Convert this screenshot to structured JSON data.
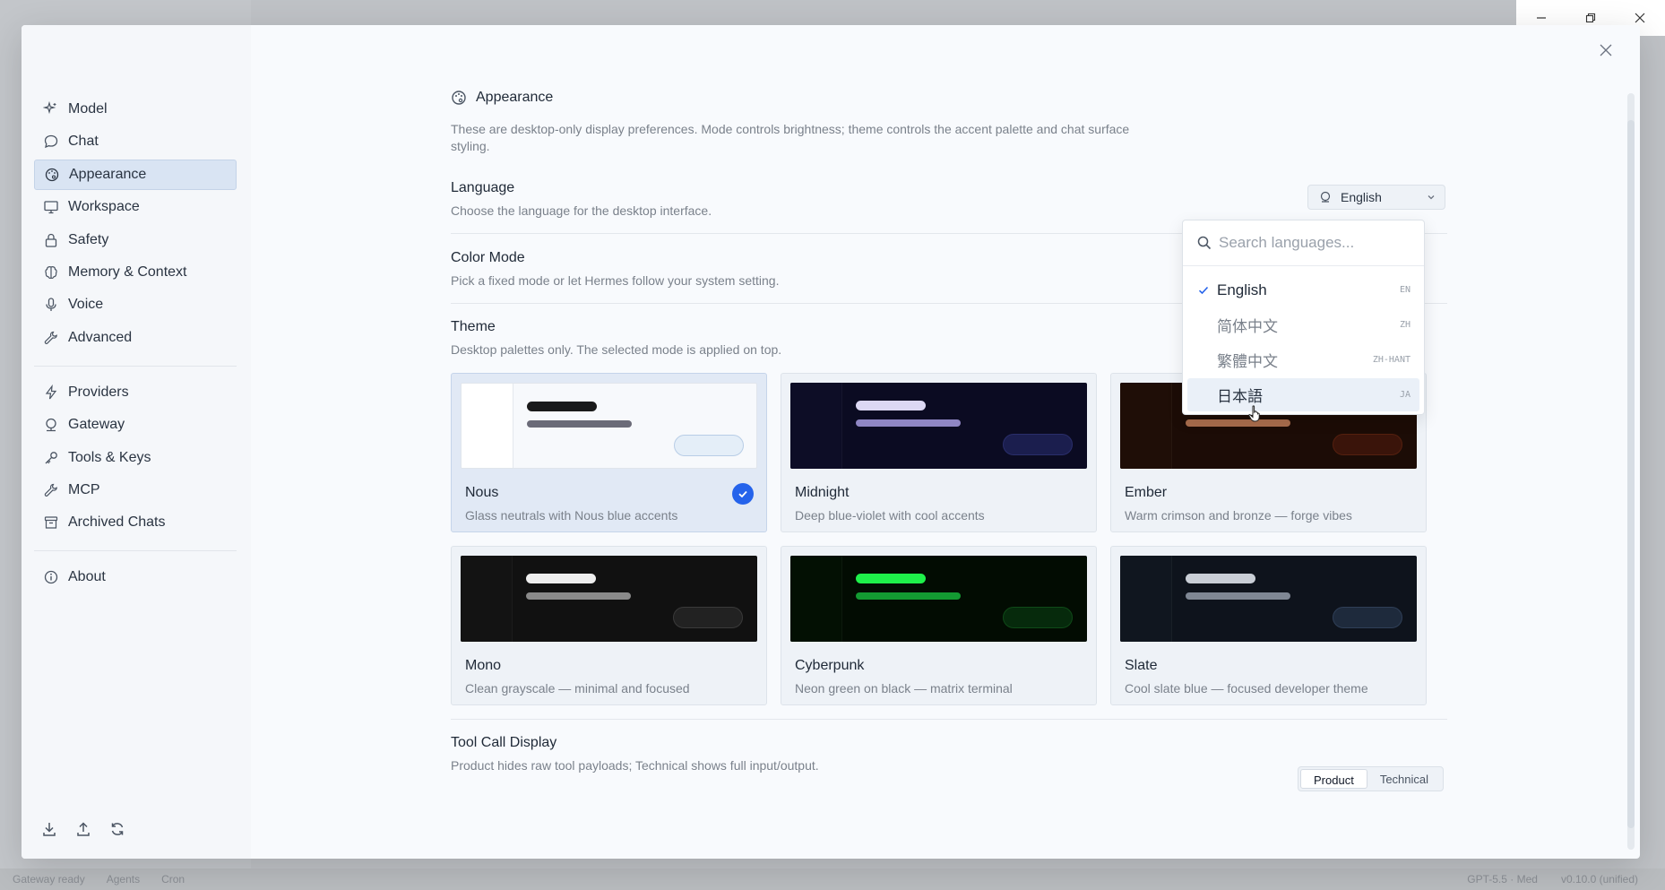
{
  "statusbar": {
    "left": [
      "Gateway ready",
      "Agents",
      "Cron"
    ],
    "right": [
      "GPT-5.5 · Med",
      "v0.10.0 (unified)"
    ]
  },
  "sidebar": {
    "items": [
      {
        "label": "Model",
        "icon": "sparkles-icon"
      },
      {
        "label": "Chat",
        "icon": "chat-bubble-icon"
      },
      {
        "label": "Appearance",
        "icon": "palette-icon",
        "active": true
      },
      {
        "label": "Workspace",
        "icon": "monitor-icon"
      },
      {
        "label": "Safety",
        "icon": "lock-icon"
      },
      {
        "label": "Memory & Context",
        "icon": "brain-icon"
      },
      {
        "label": "Voice",
        "icon": "microphone-icon"
      },
      {
        "label": "Advanced",
        "icon": "wrench-icon"
      },
      {
        "label": "Providers",
        "icon": "bolt-icon"
      },
      {
        "label": "Gateway",
        "icon": "globe-icon"
      },
      {
        "label": "Tools & Keys",
        "icon": "key-icon"
      },
      {
        "label": "MCP",
        "icon": "wrench-icon"
      },
      {
        "label": "Archived Chats",
        "icon": "archive-icon"
      },
      {
        "label": "About",
        "icon": "info-icon"
      }
    ],
    "footer_icons": [
      "download-icon",
      "upload-icon",
      "refresh-icon"
    ]
  },
  "page": {
    "title": "Appearance",
    "description": "These are desktop-only display preferences. Mode controls brightness; theme controls the accent palette and chat surface styling."
  },
  "language": {
    "title": "Language",
    "subtitle": "Choose the language for the desktop interface.",
    "selected": "English"
  },
  "color_mode": {
    "title": "Color Mode",
    "subtitle": "Pick a fixed mode or let Hermes follow your system setting."
  },
  "theme": {
    "title": "Theme",
    "subtitle": "Desktop palettes only. The selected mode is applied on top.",
    "cards": [
      {
        "name": "Nous",
        "desc": "Glass neutrals with Nous blue accents",
        "selected": true,
        "bg": "#f7f9fc",
        "side": "#ffffff",
        "bar1": "#1a1a1a",
        "bar2": "#6b6b78",
        "pill": "#e4eef8",
        "pill_border": "#b8cde6"
      },
      {
        "name": "Midnight",
        "desc": "Deep blue-violet with cool accents",
        "bg": "#0b0b22",
        "side": "#0d0d26",
        "bar1": "#dcd8f4",
        "bar2": "#8f86c4",
        "pill": "#1b1e4e",
        "pill_border": "#2a2e6a"
      },
      {
        "name": "Ember",
        "desc": "Warm crimson and bronze — forge vibes",
        "bg": "#1c0c06",
        "side": "#1f0e07",
        "bar1": "#e8b7a0",
        "bar2": "#a86c4c",
        "pill": "#3a140a",
        "pill_border": "#55200f"
      },
      {
        "name": "Mono",
        "desc": "Clean grayscale — minimal and focused",
        "bg": "#111111",
        "side": "#131313",
        "bar1": "#eeeeee",
        "bar2": "#8a8a8a",
        "pill": "#222222",
        "pill_border": "#3a3a3a"
      },
      {
        "name": "Cyberpunk",
        "desc": "Neon green on black — matrix terminal",
        "bg": "#020c02",
        "side": "#031003",
        "bar1": "#1ef04a",
        "bar2": "#139a32",
        "pill": "#062a0c",
        "pill_border": "#0f4a18"
      },
      {
        "name": "Slate",
        "desc": "Cool slate blue — focused developer theme",
        "bg": "#0e131c",
        "side": "#10161f",
        "bar1": "#c9ced6",
        "bar2": "#7f8794",
        "pill": "#1e2a3c",
        "pill_border": "#2f3f57"
      }
    ]
  },
  "tool_call": {
    "title": "Tool Call Display",
    "subtitle": "Product hides raw tool payloads; Technical shows full input/output.",
    "options": [
      "Product",
      "Technical"
    ],
    "selected": "Product"
  },
  "language_dropdown": {
    "placeholder": "Search languages...",
    "options": [
      {
        "label": "English",
        "code": "EN",
        "selected": true
      },
      {
        "label": "简体中文",
        "code": "ZH"
      },
      {
        "label": "繁體中文",
        "code": "ZH-HANT"
      },
      {
        "label": "日本語",
        "code": "JA",
        "hover": true
      }
    ]
  },
  "colors": {
    "accent": "#2563eb",
    "active_nav": "#d9e4f3"
  }
}
